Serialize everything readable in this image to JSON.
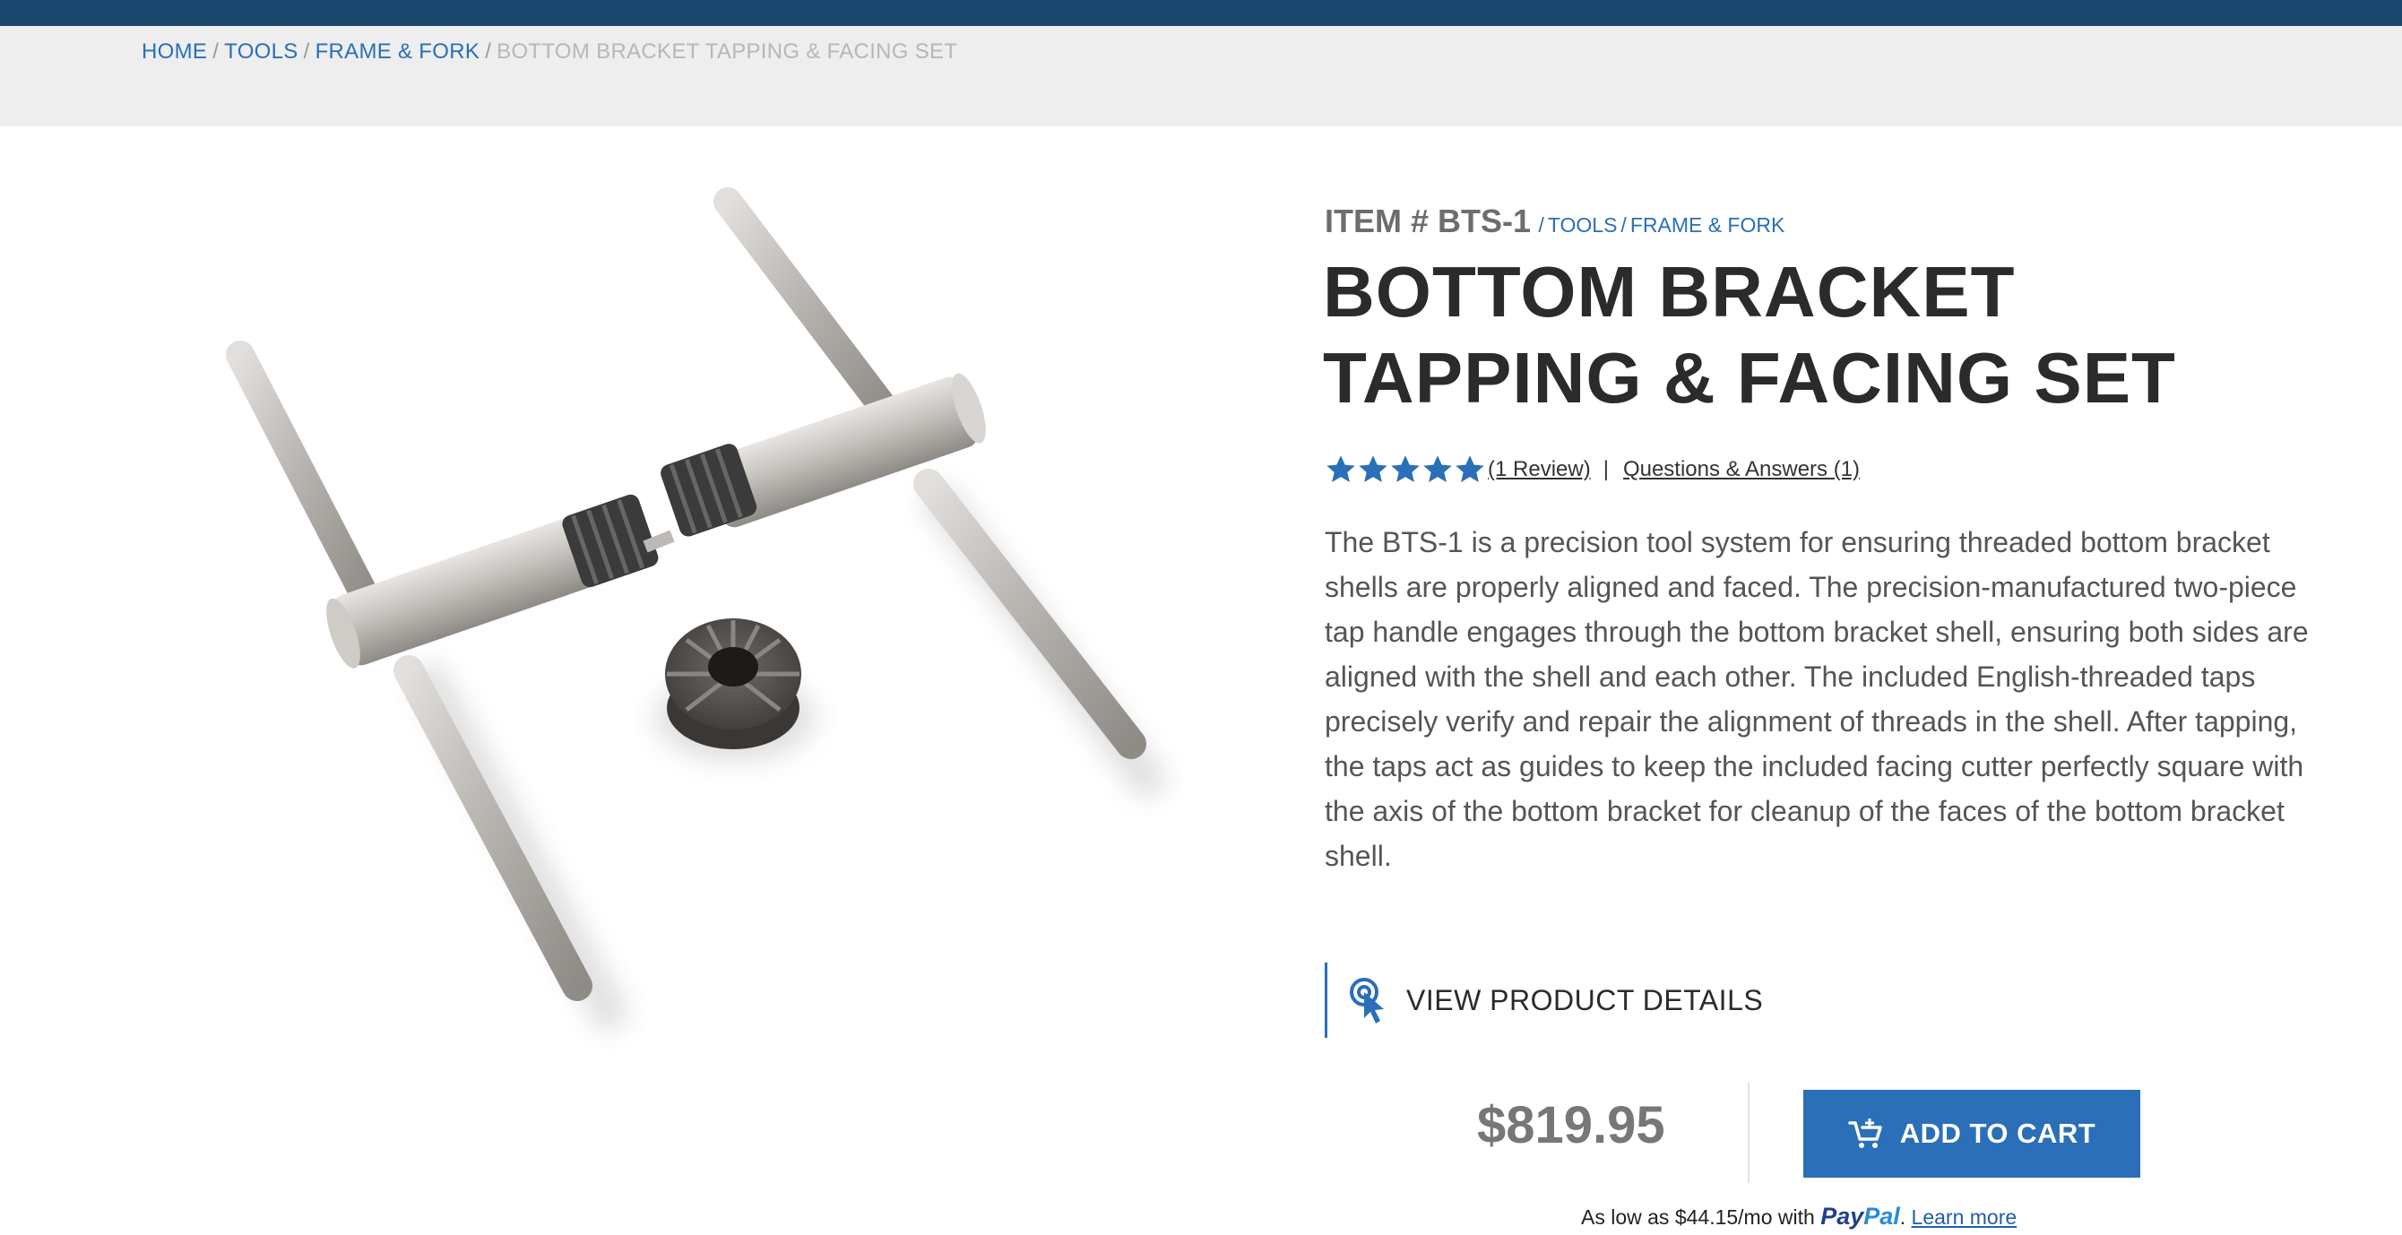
{
  "breadcrumb": {
    "items": [
      "HOME",
      "TOOLS",
      "FRAME & FORK"
    ],
    "current": "BOTTOM BRACKET TAPPING & FACING SET",
    "separator": "/"
  },
  "product": {
    "item_number": "ITEM # BTS-1",
    "categories": [
      "TOOLS",
      "FRAME & FORK"
    ],
    "title": "BOTTOM BRACKET TAPPING & FACING SET",
    "rating": 5,
    "rating_max": 5,
    "review_link": "(1 Review)",
    "qa_link": "Questions & Answers (1)",
    "description": "The BTS-1 is a precision tool system for ensuring threaded bottom bracket shells are properly aligned and faced. The precision-manufactured two-piece tap handle engages through the bottom bracket shell, ensuring both sides are aligned with the shell and each other. The included English-threaded taps precisely verify and repair the alignment of threads in the shell. After tapping, the taps act as guides to keep the included facing cutter perfectly square with the axis of the bottom bracket for cleanup of the faces of the bottom bracket shell.",
    "details_button": "VIEW PRODUCT DETAILS",
    "price": "$819.95",
    "add_to_cart": "ADD TO CART",
    "financing": {
      "prefix": "As low as $44.15/mo with",
      "brand_pay": "Pay",
      "brand_pal": "Pal",
      "suffix": ".",
      "learn_more": "Learn more"
    }
  },
  "colors": {
    "topbar": "#1c4870",
    "link_blue": "#2a6fb8",
    "button_blue": "#2a6fb8",
    "star_blue": "#2a6fb8",
    "crumb_bg": "#eeeeee"
  },
  "icons": {
    "details": "pointer-click-icon",
    "cart": "cart-add-icon",
    "star": "star-icon"
  }
}
